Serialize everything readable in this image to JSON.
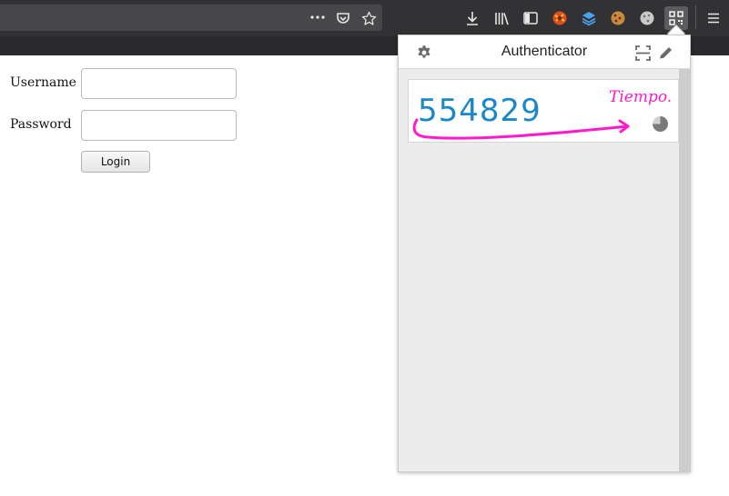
{
  "browser": {
    "toolbar_icons": [
      "more-dots-icon",
      "pocket-icon",
      "bookmark-star-icon",
      "download-icon",
      "library-icon",
      "sidebar-icon",
      "extension-icon",
      "extension-layers-icon",
      "cookie-icon",
      "cookie-gray-icon",
      "qr-authenticator-icon",
      "hamburger-menu-icon"
    ]
  },
  "login_form": {
    "username_label": "Username",
    "username_value": "",
    "password_label": "Password",
    "password_value": "",
    "login_button": "Login"
  },
  "authenticator": {
    "title": "Authenticator",
    "header_icons": [
      "gear-icon",
      "scan-qr-icon",
      "edit-pencil-icon"
    ],
    "entries": [
      {
        "code": "554829",
        "timer_fraction_remaining": 0.75
      }
    ],
    "annotation": {
      "text": "Tiempo.",
      "color": "#ff1acb"
    },
    "code_color": "#1a88c8"
  }
}
